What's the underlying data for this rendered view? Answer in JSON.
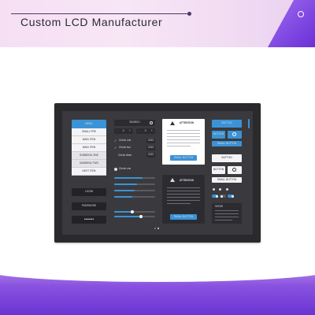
{
  "brand": {
    "title": "Custom LCD Manufacturer"
  },
  "screen": {
    "menu": {
      "header": "MENU",
      "items": [
        "SMALL PRE",
        "MAIN ITEM",
        "MAIN ITEM",
        "SUBMENU ONE",
        "SUBMENU TWO",
        "NEXT ITEM"
      ]
    },
    "login": {
      "username_label": "LOGIN",
      "password_label": "PASSWORD",
      "password_mask": "•••••••"
    },
    "search": {
      "placeholder": "SEARCH"
    },
    "steppers": [
      {
        "minus": "-",
        "value": "0",
        "plus": "+"
      },
      {
        "minus": "-",
        "value": "0",
        "plus": "+"
      }
    ],
    "checks": [
      {
        "label": "Check one",
        "value": "2013"
      },
      {
        "label": "Check two",
        "value": "2013"
      },
      {
        "label": "Check three",
        "value": "2013"
      }
    ],
    "radio": {
      "label": "Check one"
    },
    "progress": [
      0.7,
      0.55,
      0.5,
      0.45
    ],
    "sliders": [
      0.45,
      0.65
    ],
    "alert_top": {
      "title": "ATTENTION",
      "button": "SMALL BUTTON"
    },
    "alert_bottom": {
      "title": "ATTENTION",
      "button": "SMALL BUTTON"
    },
    "buttons": {
      "button_blue": "BUTTON",
      "button_icon_label": "BUTTON",
      "small_button_blue": "SMALL BUTTON",
      "button_white": "BUTTON",
      "button_white_icon_label": "BUTTON",
      "small_button_white": "SMALL BUTTON"
    },
    "toggle_states": [
      true,
      false,
      true
    ],
    "dark_panel": {
      "title": "SHOW"
    },
    "pager": {
      "active_index": 1,
      "count": 2
    },
    "colors": {
      "accent": "#3a93d6",
      "panel": "#2c2c30",
      "screen": "#3a3a3e",
      "device": "#2a2a2d"
    }
  }
}
